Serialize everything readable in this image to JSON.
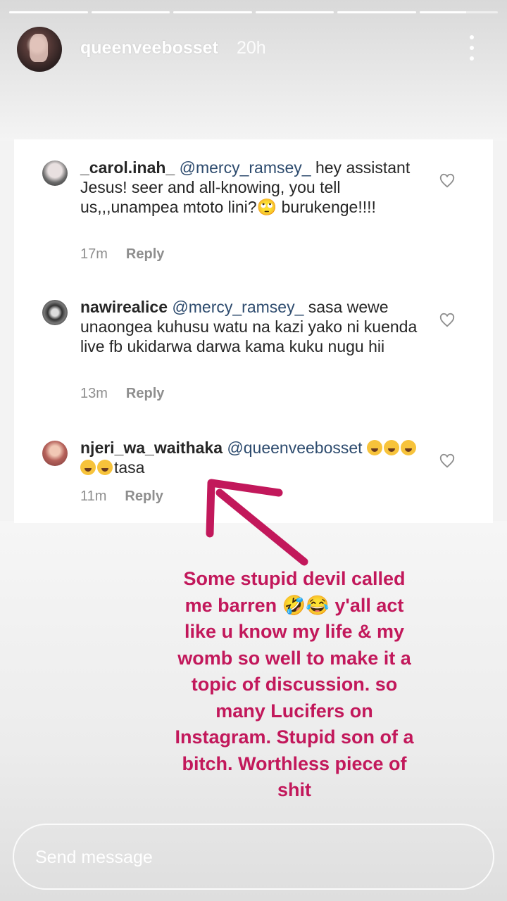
{
  "story": {
    "username": "queenveebosset",
    "time": "20h",
    "progress": [
      1,
      1,
      1,
      1,
      1,
      0.6
    ]
  },
  "comments": [
    {
      "user": "_carol.inah_",
      "mention": "@mercy_ramsey_",
      "text": " hey assistant Jesus! seer and all-knowing, you tell us,,,unampea mtoto lini?🙄 burukenge!!!!",
      "time": "17m",
      "reply": "Reply"
    },
    {
      "user": "nawirealice",
      "mention": "@mercy_ramsey_",
      "text": " sasa wewe unaongea kuhusu watu na kazi yako ni kuenda live fb ukidarwa darwa kama kuku nugu hii",
      "time": "13m",
      "reply": "Reply"
    },
    {
      "user": "njeri_wa_waithaka",
      "mention": "@queenveebosset",
      "text": "tasa",
      "emoji_count": 5,
      "time": "11m",
      "reply": "Reply"
    }
  ],
  "annotation": "Some stupid devil called me barren 🤣😂 y'all act like u know my life & my womb so well to make it a topic of discussion. so many Lucifers on Instagram. Stupid son of a bitch. Worthless piece of shit",
  "send": {
    "placeholder": "Send message"
  },
  "colors": {
    "annotation": "#c2185b",
    "mention": "#2d4b6e"
  }
}
